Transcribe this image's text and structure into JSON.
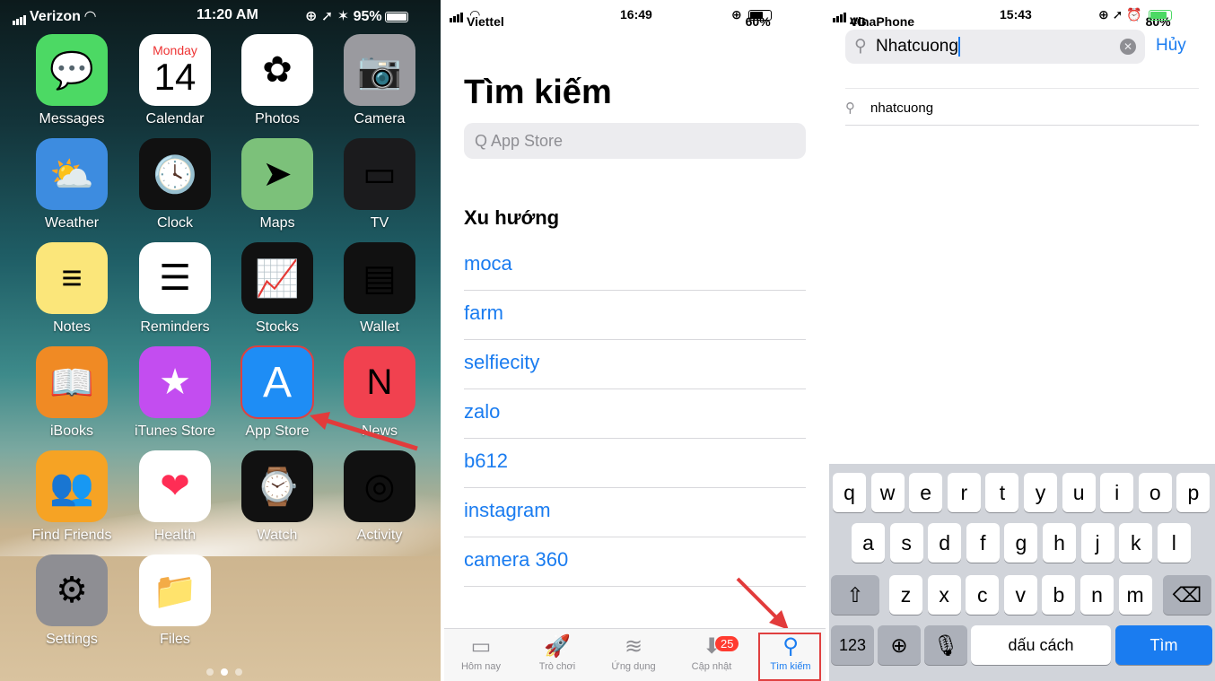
{
  "home": {
    "status": {
      "carrier": "Verizon",
      "time": "11:20 AM",
      "battery": "95%"
    },
    "apps": [
      {
        "label": "Messages",
        "icon": "messages-icon",
        "color": "#4cd964",
        "glyph": "💬"
      },
      {
        "label": "Calendar",
        "icon": "calendar-icon",
        "color": "#ffffff",
        "day": "Monday",
        "date": "14"
      },
      {
        "label": "Photos",
        "icon": "photos-icon",
        "color": "#ffffff",
        "glyph": "✿"
      },
      {
        "label": "Camera",
        "icon": "camera-icon",
        "color": "#9a9a9f",
        "glyph": "📷"
      },
      {
        "label": "Weather",
        "icon": "weather-icon",
        "color": "#3d8ce0",
        "glyph": "⛅"
      },
      {
        "label": "Clock",
        "icon": "clock-icon",
        "color": "#111111",
        "glyph": "🕓"
      },
      {
        "label": "Maps",
        "icon": "maps-icon",
        "color": "#7cc17a",
        "glyph": "➤"
      },
      {
        "label": "TV",
        "icon": "tv-icon",
        "color": "#1b1b1d",
        "glyph": "▭"
      },
      {
        "label": "Notes",
        "icon": "notes-icon",
        "color": "#fbe67a",
        "glyph": "≡"
      },
      {
        "label": "Reminders",
        "icon": "reminders-icon",
        "color": "#ffffff",
        "glyph": "☰"
      },
      {
        "label": "Stocks",
        "icon": "stocks-icon",
        "color": "#111111",
        "glyph": "📈"
      },
      {
        "label": "Wallet",
        "icon": "wallet-icon",
        "color": "#111111",
        "glyph": "▤"
      },
      {
        "label": "iBooks",
        "icon": "ibooks-icon",
        "color": "#f08a24",
        "glyph": "📖"
      },
      {
        "label": "iTunes Store",
        "icon": "itunes-store-icon",
        "color": "#c34df0",
        "glyph": "★"
      },
      {
        "label": "App Store",
        "icon": "app-store-icon",
        "color": "#1e8df5",
        "glyph": "A"
      },
      {
        "label": "News",
        "icon": "news-icon",
        "color": "#f1414f",
        "glyph": "N"
      },
      {
        "label": "Find Friends",
        "icon": "find-friends-icon",
        "color": "#f6a324",
        "glyph": "👥"
      },
      {
        "label": "Health",
        "icon": "health-icon",
        "color": "#ffffff",
        "glyph": "❤"
      },
      {
        "label": "Watch",
        "icon": "watch-icon",
        "color": "#111111",
        "glyph": "⌚"
      },
      {
        "label": "Activity",
        "icon": "activity-icon",
        "color": "#111111",
        "glyph": "◎"
      },
      {
        "label": "Settings",
        "icon": "settings-icon",
        "color": "#8e8e93",
        "glyph": "⚙"
      },
      {
        "label": "Files",
        "icon": "files-icon",
        "color": "#ffffff",
        "glyph": "📁"
      }
    ]
  },
  "store": {
    "status": {
      "carrier": "Viettel",
      "time": "16:49",
      "battery": "60%"
    },
    "title": "Tìm kiếm",
    "search_placeholder": "Q  App Store",
    "trending_heading": "Xu hướng",
    "trending": [
      "moca",
      "farm",
      "selfiecity",
      "zalo",
      "b612",
      "instagram",
      "camera 360"
    ],
    "tabs": [
      {
        "label": "Hôm nay",
        "icon": "today-icon",
        "glyph": "▭"
      },
      {
        "label": "Trò chơi",
        "icon": "games-icon",
        "glyph": "🚀"
      },
      {
        "label": "Ứng dụng",
        "icon": "apps-icon",
        "glyph": "≋"
      },
      {
        "label": "Cập nhật",
        "icon": "updates-icon",
        "glyph": "⬇",
        "badge": "25"
      },
      {
        "label": "Tìm kiếm",
        "icon": "search-icon",
        "glyph": "⚲"
      }
    ]
  },
  "search": {
    "status": {
      "carrier": "VinaPhone",
      "network": "4G",
      "time": "15:43",
      "battery": "80%"
    },
    "query": "Nhatcuong",
    "cancel_label": "Hủy",
    "suggestion": "nhatcuong",
    "keys_row1": [
      "q",
      "w",
      "e",
      "r",
      "t",
      "y",
      "u",
      "i",
      "o",
      "p"
    ],
    "keys_row2": [
      "a",
      "s",
      "d",
      "f",
      "g",
      "h",
      "j",
      "k",
      "l"
    ],
    "keys_row3": [
      "z",
      "x",
      "c",
      "v",
      "b",
      "n",
      "m"
    ],
    "key_numbers": "123",
    "key_space": "dấu cách",
    "key_search": "Tìm"
  }
}
